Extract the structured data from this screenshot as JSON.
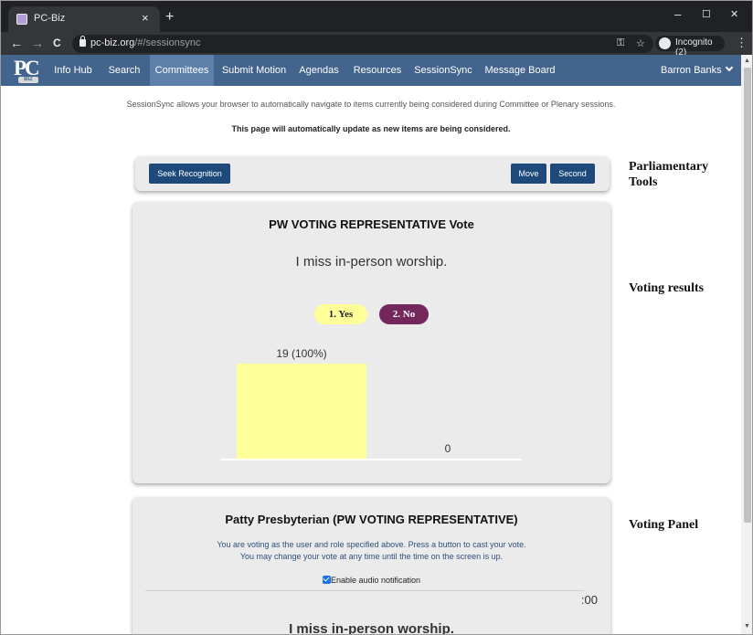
{
  "browser": {
    "tab_title": "PC-Biz",
    "tab_close": "×",
    "new_tab": "+",
    "win_min": "–",
    "win_max": "☐",
    "win_close": "✕",
    "back": "←",
    "forward": "→",
    "reload": "C",
    "url_host": "pc-biz.org",
    "url_path": "/#/sessionsync",
    "key_icon": "⚿",
    "star_icon": "☆",
    "incognito_label": "Incognito (2)",
    "menu": "⋮"
  },
  "site": {
    "logo_text": "PC",
    "logo_sub": "BIZ",
    "nav": [
      {
        "label": "Info Hub"
      },
      {
        "label": "Search"
      },
      {
        "label": "Committees"
      },
      {
        "label": "Submit Motion"
      },
      {
        "label": "Agendas"
      },
      {
        "label": "Resources"
      },
      {
        "label": "SessionSync"
      },
      {
        "label": "Message Board"
      }
    ],
    "active_nav": "Committees",
    "user": "Barron Banks"
  },
  "intro": {
    "line1": "SessionSync allows your browser to automatically navigate to items currently being considered during Committee or Plenary sessions.",
    "line2": "This page will automatically update as new items are being considered."
  },
  "tools": {
    "seek": "Seek Recognition",
    "move": "Move",
    "second": "Second",
    "side_label_1": "Parliamentary",
    "side_label_2": "Tools"
  },
  "results": {
    "title": "PW VOTING REPRESENTATIVE Vote",
    "question": "I miss in-person worship.",
    "option1": "1. Yes",
    "option2": "2. No",
    "side_label": "Voting results",
    "colors": {
      "yes": "#ffff99",
      "no": "#74275a"
    }
  },
  "chart_data": {
    "type": "bar",
    "categories": [
      "1. Yes",
      "2. No"
    ],
    "values": [
      19,
      0
    ],
    "data_labels": [
      "19 (100%)",
      "0"
    ],
    "ylim": [
      0,
      19
    ]
  },
  "panel": {
    "name": "Patty Presbyterian (PW VOTING REPRESENTATIVE)",
    "info1": "You are voting as the user and role specified above. Press a button to cast your vote.",
    "info2": "You may change your vote at any time until the time on the screen is up.",
    "audio": "Enable audio notification",
    "timer": ":00",
    "question": "I miss in-person worship.",
    "side_label": "Voting Panel"
  }
}
